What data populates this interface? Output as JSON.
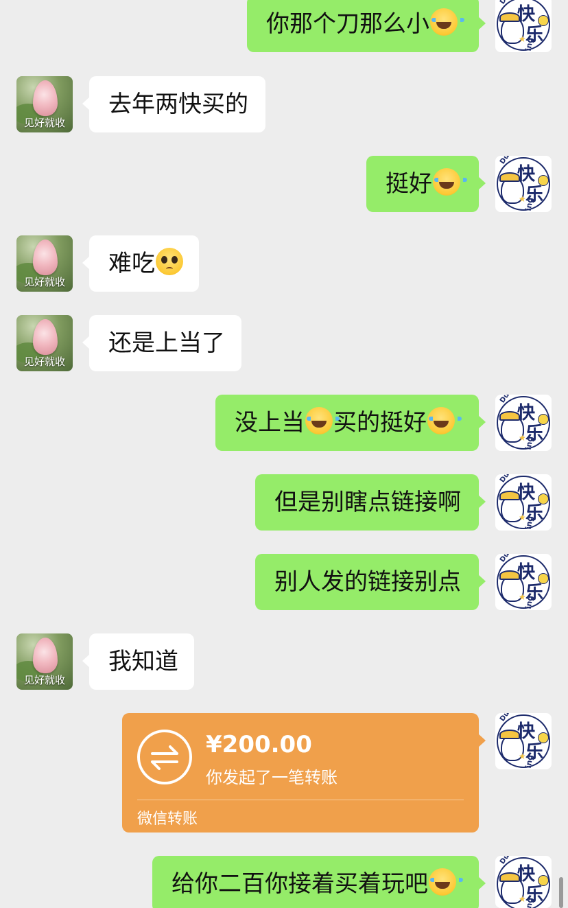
{
  "chat": {
    "contact_avatar_caption": "见好就收",
    "self_avatar": {
      "brand_text": "Duke Duck",
      "word1": "快",
      "word2": "乐",
      "suffix": "ing"
    },
    "messages": [
      {
        "side": "right",
        "text": "你那个刀那么小",
        "emoji_after": "laugh-cry"
      },
      {
        "side": "left",
        "text": "去年两快买的"
      },
      {
        "side": "right",
        "text": "挺好",
        "emoji_after": "laugh-cry"
      },
      {
        "side": "left",
        "text": "难吃",
        "emoji_after": "pleading"
      },
      {
        "side": "left",
        "text": "还是上当了"
      },
      {
        "side": "right",
        "text_a": "没上当",
        "text_b": "买的挺好",
        "emoji": "laugh-cry"
      },
      {
        "side": "right",
        "text": "但是别瞎点链接啊"
      },
      {
        "side": "right",
        "text": "别人发的链接别点"
      },
      {
        "side": "left",
        "text": "我知道"
      },
      {
        "side": "right",
        "text": "给你二百你接着买着玩吧",
        "emoji_after": "laugh-cry"
      }
    ],
    "transfer": {
      "amount": "¥200.00",
      "description": "你发起了一笔转账",
      "footer": "微信转账",
      "icon": "transfer-arrows-icon"
    }
  },
  "colors": {
    "background": "#ededed",
    "self_bubble": "#95ec69",
    "other_bubble": "#ffffff",
    "transfer_card": "#f0a04b"
  }
}
